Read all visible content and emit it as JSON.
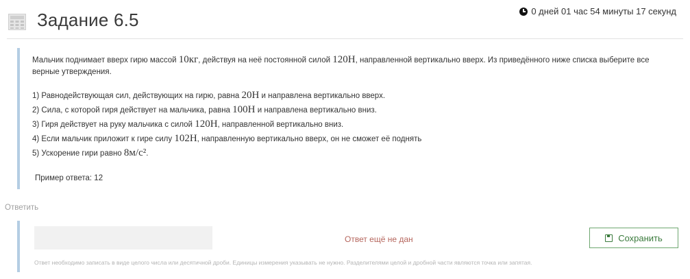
{
  "header": {
    "title": "Задание 6.5",
    "timer": "0 дней 01 час 54 минуты 17 секунд"
  },
  "question": {
    "intro_1": "Мальчик поднимает вверх гирю массой ",
    "mass": "10кг",
    "intro_2": ", действуя на неё постоянной силой ",
    "force": "120Н",
    "intro_3": ", направленной вертикально вверх. Из приведённого ниже списка выберите все верные утверждения.",
    "options": [
      {
        "a": "1) Равнодействующая сил, действующих на гирю, равна ",
        "m": "20Н",
        "b": " и направлена вертикально вверх."
      },
      {
        "a": "2) Сила, с которой гиря действует на мальчика, равна ",
        "m": "100Н",
        "b": " и направлена вертикально вниз."
      },
      {
        "a": "3) Гиря действует на руку мальчика с силой ",
        "m": "120Н",
        "b": ", направленной вертикально вниз."
      },
      {
        "a": "4) Если мальчик приложит к гире силу ",
        "m": "102Н",
        "b": ", направленную вертикально вверх, он не сможет её поднять"
      },
      {
        "a": "5) Ускорение гири равно ",
        "m": "8м/с²",
        "b": "."
      }
    ],
    "example": "Пример ответа: 12"
  },
  "answer": {
    "label": "Ответить",
    "input_value": "",
    "status": "Ответ ещё не дан",
    "save_label": "Сохранить",
    "hint": "Ответ необходимо записать в виде целого числа или десятичной дроби. Единицы измерения указывать не нужно. Разделителями целой и дробной части являются точка или запятая."
  },
  "icons": {
    "task": "calculator-grid-icon",
    "timer": "clock-icon",
    "save": "floppy-disk-icon"
  },
  "colors": {
    "accent_border": "#b4cde3",
    "save_green": "#3a7a3c",
    "status_red": "#b5655c"
  }
}
